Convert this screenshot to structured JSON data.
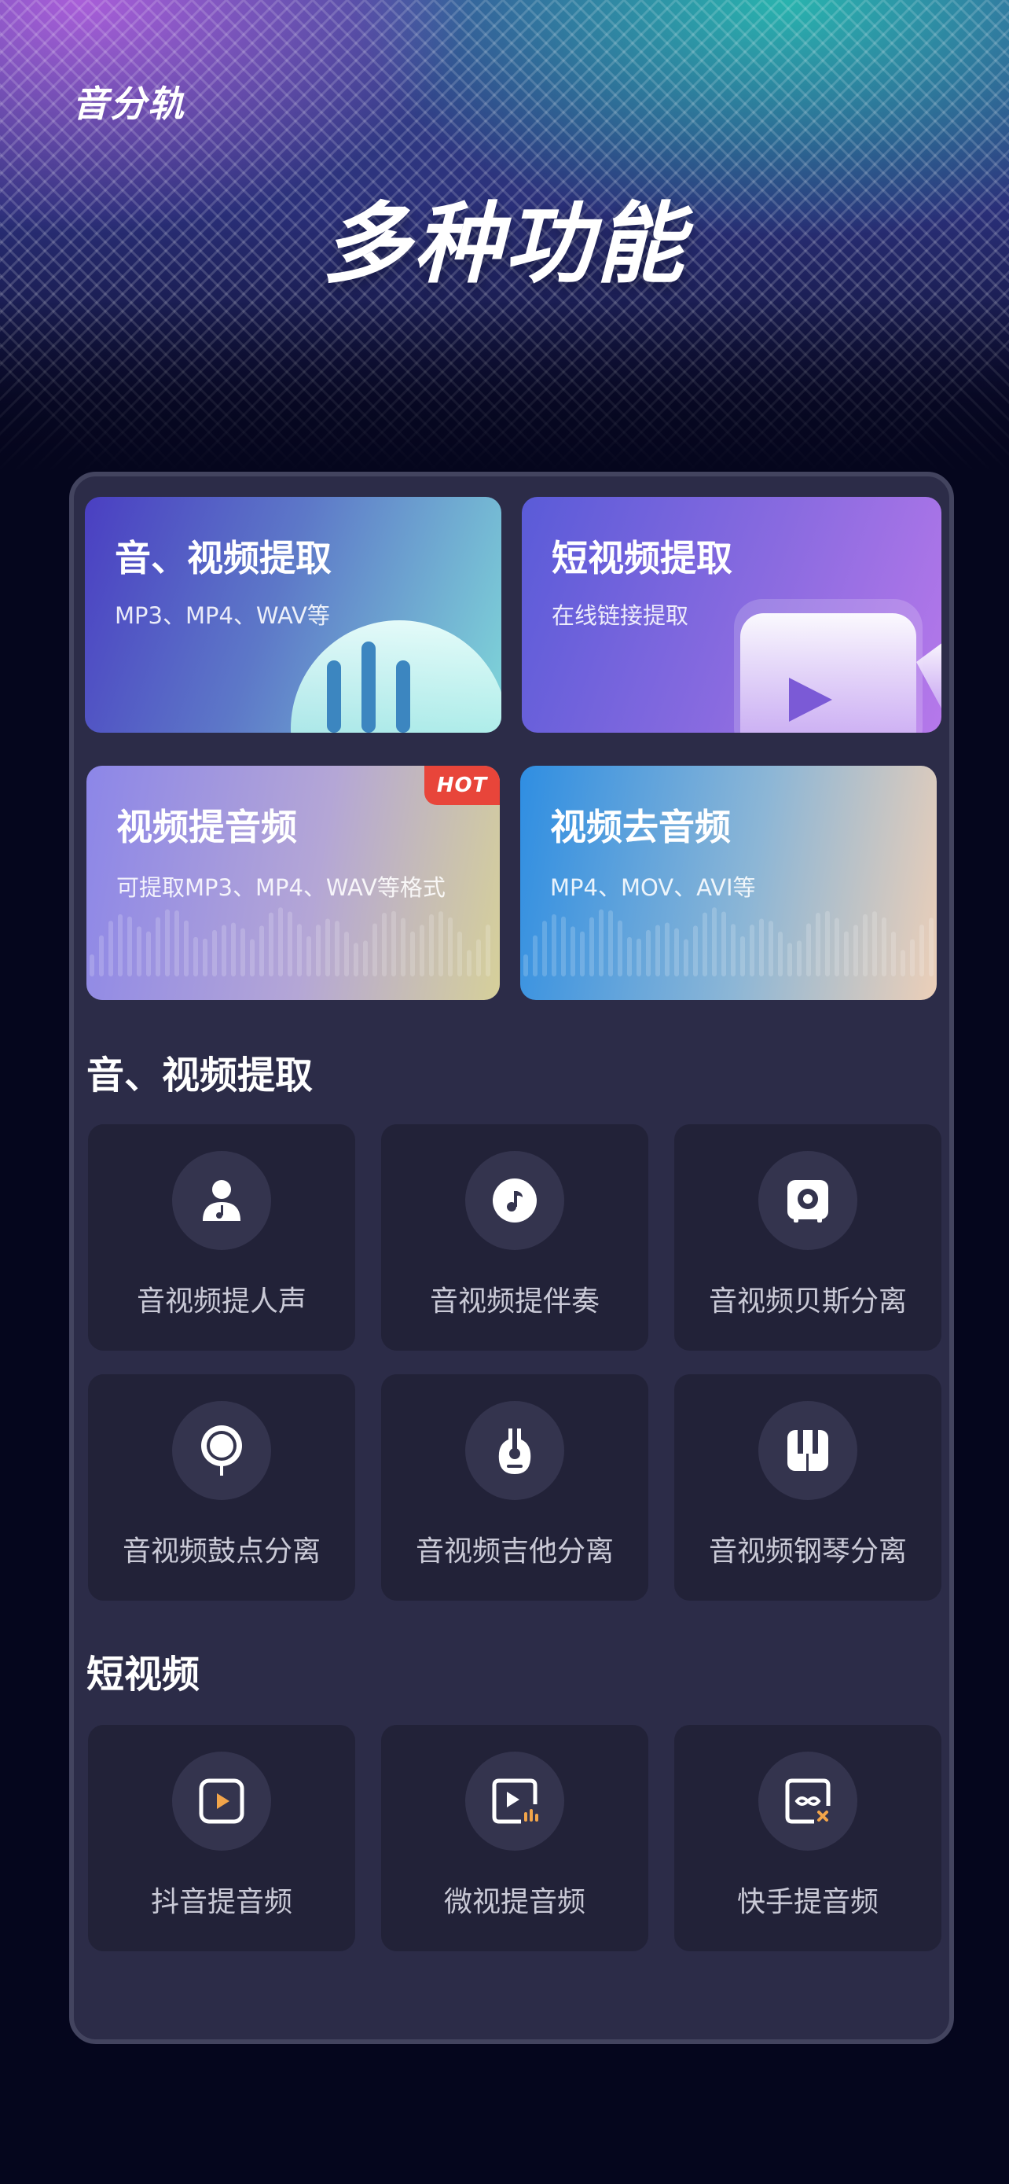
{
  "header": {
    "brand": "音分轨",
    "title": "多种功能"
  },
  "features": [
    {
      "title": "音、视频提取",
      "subtitle": "MP3、MP4、WAV等"
    },
    {
      "title": "短视频提取",
      "subtitle": "在线链接提取"
    },
    {
      "title": "视频提音频",
      "subtitle": "可提取MP3、MP4、WAV等格式",
      "badge": "HOT"
    },
    {
      "title": "视频去音频",
      "subtitle": "MP4、MOV、AVI等"
    }
  ],
  "av_section": {
    "title": "音、视频提取",
    "tools": [
      {
        "label": "音视频提人声",
        "icon": "person-music-icon"
      },
      {
        "label": "音视频提伴奏",
        "icon": "music-note-icon"
      },
      {
        "label": "音视频贝斯分离",
        "icon": "speaker-icon"
      },
      {
        "label": "音视频鼓点分离",
        "icon": "drum-icon"
      },
      {
        "label": "音视频吉他分离",
        "icon": "guitar-icon"
      },
      {
        "label": "音视频钢琴分离",
        "icon": "piano-icon"
      }
    ]
  },
  "short_section": {
    "title": "短视频",
    "tools": [
      {
        "label": "抖音提音频",
        "icon": "douyin-video-icon"
      },
      {
        "label": "微视提音频",
        "icon": "weishi-video-icon"
      },
      {
        "label": "快手提音频",
        "icon": "kuaishou-video-icon"
      }
    ]
  },
  "colors": {
    "background": "#05061d",
    "panel": "#2c2c48",
    "tile": "#222238",
    "icon_circle": "#34344e",
    "accent_orange": "#f2a54a",
    "hot_red": "#e8453a"
  }
}
